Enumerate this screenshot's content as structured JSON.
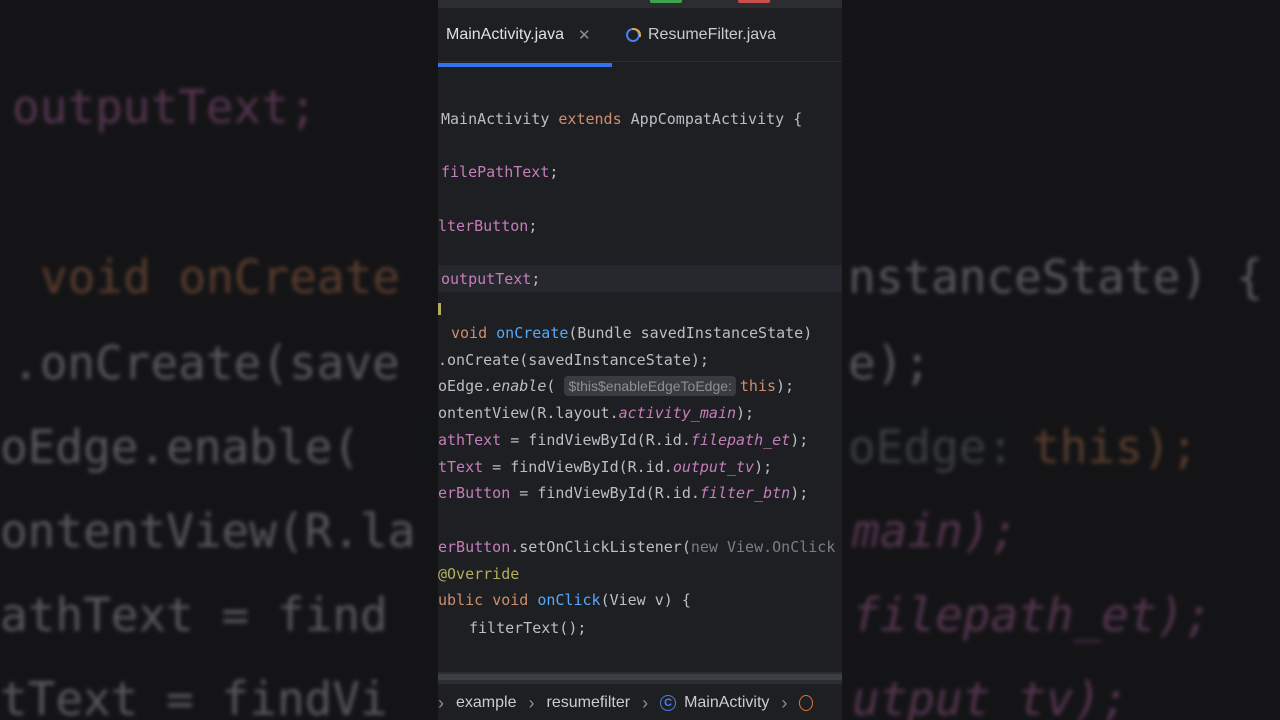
{
  "tabs": [
    {
      "label": "MainActivity.java",
      "active": true,
      "close": "✕"
    },
    {
      "label": "ResumeFilter.java",
      "active": false
    }
  ],
  "code_lines": [
    "MainActivity extends AppCompatActivity {",
    "filePathText;",
    "lterButton;",
    "outputText;",
    "void onCreate(Bundle savedInstanceState)",
    ".onCreate(savedInstanceState);",
    "oEdge.enable( $this$enableEdgeToEdge: this);",
    "ontentView(R.layout.activity_main);",
    "athText = findViewById(R.id.filepath_et);",
    "tText = findViewById(R.id.output_tv);",
    "erButton = findViewById(R.id.filter_btn);",
    "erButton.setOnClickListener(new View.OnClick",
    "@Override",
    "ublic void onClick(View v) {",
    "filterText();"
  ],
  "tokens": {
    "class_name": "MainActivity",
    "extends": "extends",
    "super_class": "AppCompatActivity {",
    "file_path_field": "filePathText",
    "semicolon": ";",
    "filter_button_field": "lterButton",
    "output_text_field": "outputText",
    "void": "void",
    "on_create": "onCreate",
    "on_create_params": "(Bundle savedInstanceState)",
    "super_call_prefix": ".onCreate(savedInstanceState);",
    "edge_prefix": "oEdge.",
    "edge_enable": "enable",
    "edge_open": "(",
    "edge_hint": "$this$enableEdgeToEdge:",
    "edge_this": "this",
    "edge_close": ");",
    "content_view_prefix": "ontentView(R.layout.",
    "activity_main": "activity_main",
    "close_paren_semi": ");",
    "path_text_field": "athText",
    "find_view_prefix": " = findViewById(R.id.",
    "filepath_et": "filepath_et",
    "output_field_short": "tText",
    "output_tv": "output_tv",
    "filter_field_short": "erButton",
    "filter_btn": "filter_btn",
    "set_listener": ".setOnClickListener(",
    "new_view": "new View.OnClick",
    "override": "@Override",
    "public": "ublic",
    "on_click": "onClick",
    "on_click_params": "(View v) {",
    "filter_text_call": "filterText();"
  },
  "breadcrumb": {
    "items": [
      "example",
      "resumefilter",
      "MainActivity"
    ],
    "separator": "›",
    "class_icon_letter": "C"
  },
  "background_text": [
    "outputText;",
    "void onCreate",
    "nstanceState) {",
    ".onCreate(save",
    "e);",
    "oEdge.enable(",
    "oEdge:",
    "this);",
    "ontentView(R.la",
    "main);",
    "athText = find",
    "filepath_et);",
    "tText = findVi",
    "utput_tv);"
  ],
  "colors": {
    "editor_bg": "#1e1f22",
    "keyword": "#cf8e6d",
    "function": "#56a8f5",
    "field": "#c77dbb",
    "text": "#bcbec4",
    "accent": "#3574f0"
  }
}
